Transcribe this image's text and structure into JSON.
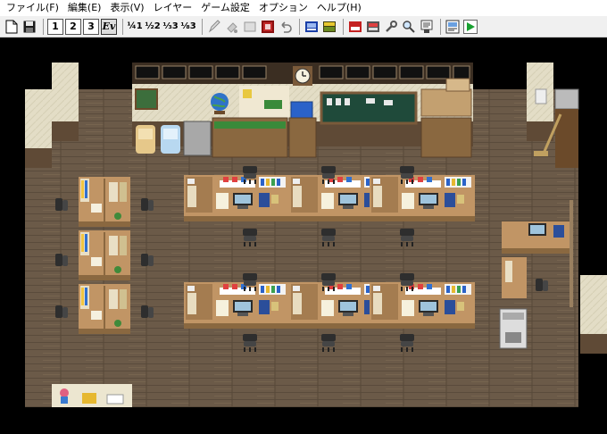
{
  "menu": {
    "items": [
      {
        "label": "ファイル(F)"
      },
      {
        "label": "編集(E)"
      },
      {
        "label": "表示(V)"
      },
      {
        "label": "レイヤー"
      },
      {
        "label": "ゲーム設定"
      },
      {
        "label": "オプション"
      },
      {
        "label": "ヘルプ(H)"
      }
    ]
  },
  "toolbar": {
    "layer_1": "1",
    "layer_2": "2",
    "layer_3": "3",
    "event_layer": "Ev",
    "zoom_1": "¼1",
    "zoom_2": "½2",
    "zoom_3": "⅓3",
    "zoom_4": "⅛3",
    "active_tool": "event_layer"
  },
  "colors": {
    "floor": "#6b5a48",
    "wall": "#e2dcc4",
    "desk": "#b58a58",
    "chair": "#3a3a3a",
    "board": "#1f4a3a",
    "accent_blue": "#2a62c9",
    "accent_green": "#18a030"
  }
}
